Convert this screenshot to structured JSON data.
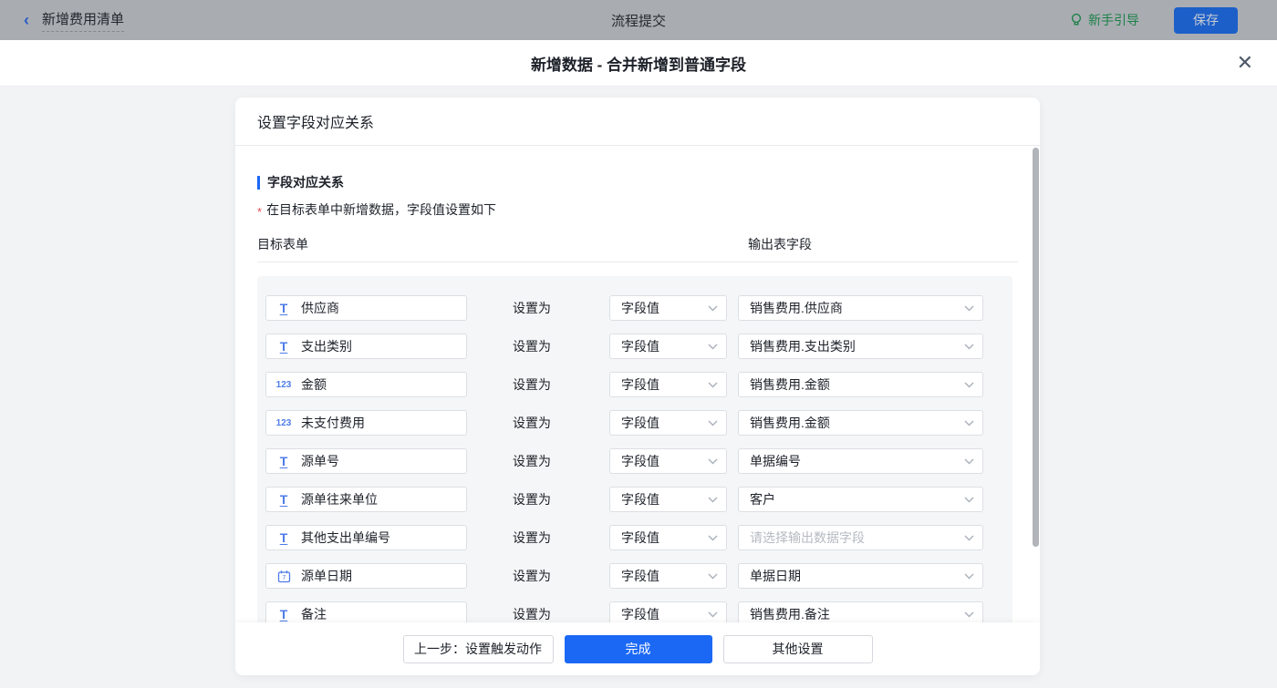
{
  "topbar": {
    "back_title": "新增费用清单",
    "center_title": "流程提交",
    "guide_label": "新手引导",
    "save_label": "保存"
  },
  "modal": {
    "title": "新增数据 - 合并新增到普通字段",
    "close_glyph": "✕"
  },
  "card": {
    "header": "设置字段对应关系",
    "section_title": "字段对应关系",
    "required_mark": "*",
    "note": "在目标表单中新增数据，字段值设置如下",
    "col_left": "目标表单",
    "col_right": "输出表字段",
    "set_as_label": "设置为"
  },
  "rows": [
    {
      "icon": "text",
      "field": "供应商",
      "mode": "字段值",
      "output": "销售费用.供应商",
      "is_placeholder": false
    },
    {
      "icon": "text",
      "field": "支出类别",
      "mode": "字段值",
      "output": "销售费用.支出类别",
      "is_placeholder": false
    },
    {
      "icon": "number",
      "field": "金额",
      "mode": "字段值",
      "output": "销售费用.金额",
      "is_placeholder": false
    },
    {
      "icon": "number",
      "field": "未支付费用",
      "mode": "字段值",
      "output": "销售费用.金额",
      "is_placeholder": false
    },
    {
      "icon": "text",
      "field": "源单号",
      "mode": "字段值",
      "output": "单据编号",
      "is_placeholder": false
    },
    {
      "icon": "text",
      "field": "源单往来单位",
      "mode": "字段值",
      "output": "客户",
      "is_placeholder": false
    },
    {
      "icon": "text",
      "field": "其他支出单编号",
      "mode": "字段值",
      "output": "请选择输出数据字段",
      "is_placeholder": true
    },
    {
      "icon": "date",
      "field": "源单日期",
      "mode": "字段值",
      "output": "单据日期",
      "is_placeholder": false
    },
    {
      "icon": "text",
      "field": "备注",
      "mode": "字段值",
      "output": "销售费用.备注",
      "is_placeholder": false
    }
  ],
  "footer": {
    "prev_label": "上一步：设置触发动作",
    "done_label": "完成",
    "other_label": "其他设置"
  },
  "colors": {
    "accent_blue": "#1b68f5",
    "field_icon_blue": "#4e7ce9",
    "guide_green": "#1e8048",
    "required_red": "#e34d59",
    "topbar_dimmed_bg": "#a9adb2",
    "panel_gray": "#f5f6f7"
  }
}
